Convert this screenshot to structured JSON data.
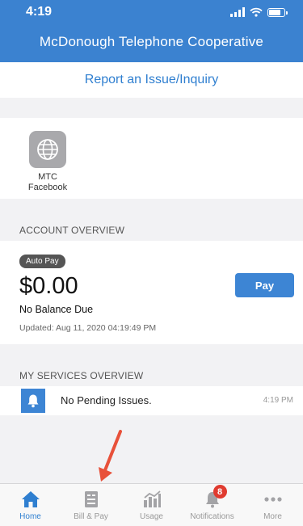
{
  "status_bar": {
    "time": "4:19"
  },
  "app": {
    "title": "McDonough Telephone Cooperative"
  },
  "report": {
    "label": "Report an Issue/Inquiry"
  },
  "shortcuts": [
    {
      "label": "MTC Facebook",
      "icon": "globe-icon"
    }
  ],
  "account_overview": {
    "heading": "ACCOUNT OVERVIEW",
    "badge": "Auto Pay",
    "balance": "$0.00",
    "pay_label": "Pay",
    "status": "No Balance Due",
    "updated": "Updated: Aug 11, 2020 04:19:49 PM"
  },
  "services_overview": {
    "heading": "MY SERVICES OVERVIEW",
    "message": "No Pending Issues.",
    "time": "4:19 PM"
  },
  "tabs": [
    {
      "label": "Home",
      "icon": "home-icon",
      "active": true
    },
    {
      "label": "Bill & Pay",
      "icon": "bill-icon",
      "active": false
    },
    {
      "label": "Usage",
      "icon": "usage-chart-icon",
      "active": false
    },
    {
      "label": "Notifications",
      "icon": "bell-icon",
      "active": false,
      "badge": "8"
    },
    {
      "label": "More",
      "icon": "more-dots-icon",
      "active": false
    }
  ],
  "colors": {
    "brand": "#3b82d0",
    "link": "#2f7fd0",
    "badge": "#e03b30",
    "arrow": "#e8513a"
  }
}
